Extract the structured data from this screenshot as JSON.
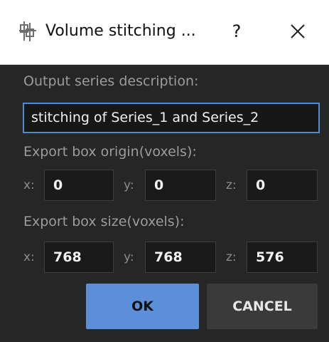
{
  "window": {
    "title": "Volume stitching ...",
    "help_label": "?",
    "icon": "sync-arrows-icon",
    "close_icon": "close-icon"
  },
  "form": {
    "description_label": "Output series description:",
    "description_value": "stitching of Series_1 and Series_2",
    "origin_label": "Export box origin(voxels):",
    "origin": {
      "x_label": "x:",
      "x": "0",
      "y_label": "y:",
      "y": "0",
      "z_label": "z:",
      "z": "0"
    },
    "size_label": "Export box size(voxels):",
    "size": {
      "x_label": "x:",
      "x": "768",
      "y_label": "y:",
      "y": "768",
      "z_label": "z:",
      "z": "576"
    }
  },
  "buttons": {
    "ok": "OK",
    "cancel": "CANCEL"
  },
  "colors": {
    "background": "#262626",
    "accent": "#5b90d9",
    "focus_border": "#4f8ad6"
  }
}
